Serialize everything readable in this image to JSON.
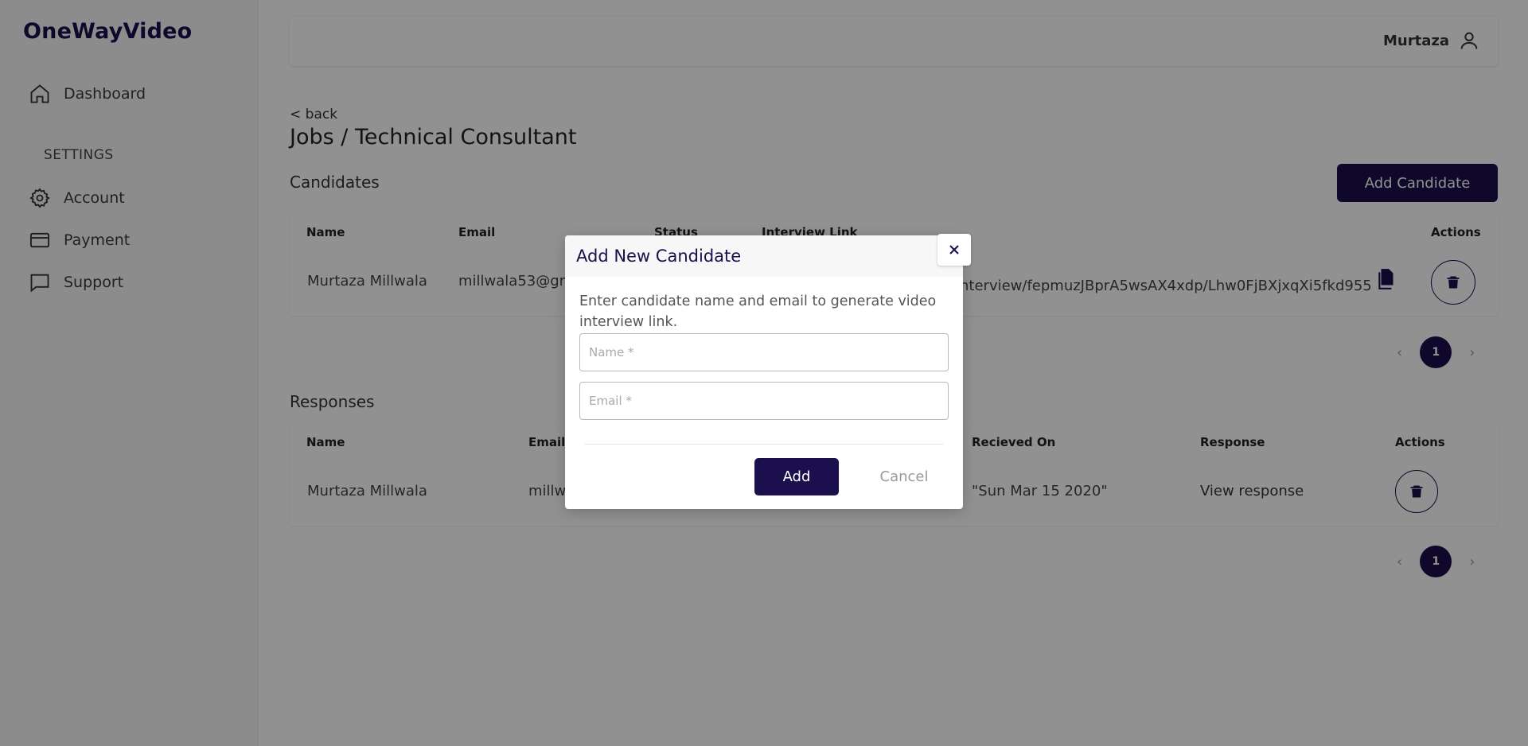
{
  "app": {
    "brand": "OneWayVideo"
  },
  "sidebar": {
    "items": [
      {
        "label": "Dashboard",
        "icon": "home-icon"
      },
      {
        "label": "Account",
        "icon": "gear-icon"
      },
      {
        "label": "Payment",
        "icon": "credit-card-icon"
      },
      {
        "label": "Support",
        "icon": "chat-icon"
      }
    ],
    "settings_heading": "SETTINGS"
  },
  "topbar": {
    "user_name": "Murtaza",
    "user_icon": "user-icon"
  },
  "page": {
    "back": "< back",
    "title": "Jobs / Technical Consultant"
  },
  "candidates": {
    "title": "Candidates",
    "add_button": "Add Candidate",
    "headers": {
      "name": "Name",
      "email": "Email",
      "status": "Status",
      "link": "Interview Link",
      "actions": "Actions"
    },
    "rows": [
      {
        "name": "Murtaza Millwala",
        "email": "millwala53@gm",
        "link": "nterview/fepmuzJBprA5wsAX4xdp/Lhw0FjBXjxqXi5fkd955"
      }
    ],
    "pagination": {
      "prev": "‹",
      "current": "1",
      "next": "›"
    }
  },
  "responses": {
    "title": "Responses",
    "headers": {
      "name": "Name",
      "email": "Email",
      "received": "Recieved On",
      "response": "Response",
      "actions": "Actions"
    },
    "rows": [
      {
        "name": "Murtaza Millwala",
        "email": "millw",
        "received": "\"Sun Mar 15 2020\"",
        "response": "View response"
      }
    ],
    "pagination": {
      "prev": "‹",
      "current": "1",
      "next": "›"
    }
  },
  "modal": {
    "title": "Add New Candidate",
    "description": "Enter candidate name and email to generate video interview link.",
    "name_placeholder": "Name *",
    "email_placeholder": "Email *",
    "add_label": "Add",
    "cancel_label": "Cancel"
  },
  "colors": {
    "brand": "#1b0f4d",
    "overlay": "rgba(0,0,0,0.43)"
  }
}
